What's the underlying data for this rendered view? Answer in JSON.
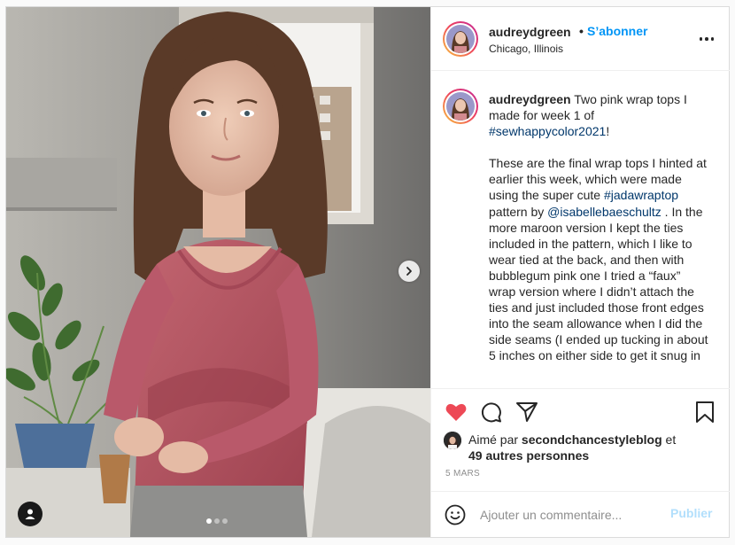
{
  "post": {
    "username": "audreydgreen",
    "follow_separator": "•",
    "follow_label": "S’abonner",
    "location": "Chicago, Illinois"
  },
  "carousel": {
    "slide_count": 3,
    "active_index": 0
  },
  "caption": {
    "username": "audreydgreen",
    "intro": " Two pink wrap tops I made for week 1 of ",
    "hashtag_1": "#sewhappycolor2021",
    "intro_end": "!",
    "body_1": "These are the final wrap tops I hinted at earlier this week, which were made using the super cute ",
    "hashtag_2": "#jadawraptop",
    "body_2": " pattern by ",
    "mention": "@isabellebaeschultz",
    "body_3": " . In the more maroon version I kept the ties included in the pattern, which I like to wear tied at the back, and then with bubblegum pink one I tried a “faux” wrap version where I didn’t attach the ties and just included those front edges into the seam allowance when I did the side seams (I ended up tucking in about 5 inches on either side to get it snug in"
  },
  "likes": {
    "prefix": "Aimé par ",
    "liker": "secondchancestyleblog",
    "joiner": " et",
    "others": "49 autres personnes"
  },
  "date": "5 MARS",
  "composer": {
    "placeholder": "Ajouter un commentaire...",
    "post_label": "Publier"
  },
  "colors": {
    "accent": "#0095f6",
    "like_red": "#ed4956",
    "post_disabled": "#b2dffc",
    "hashtag": "#00376b"
  },
  "icons": {
    "like": "heart-filled-icon",
    "comment": "speech-bubble-icon",
    "share": "paper-plane-icon",
    "save": "bookmark-icon",
    "more": "more-horizontal-icon",
    "next": "chevron-right-icon",
    "tags": "user-tag-icon",
    "emoji": "smiley-icon"
  }
}
